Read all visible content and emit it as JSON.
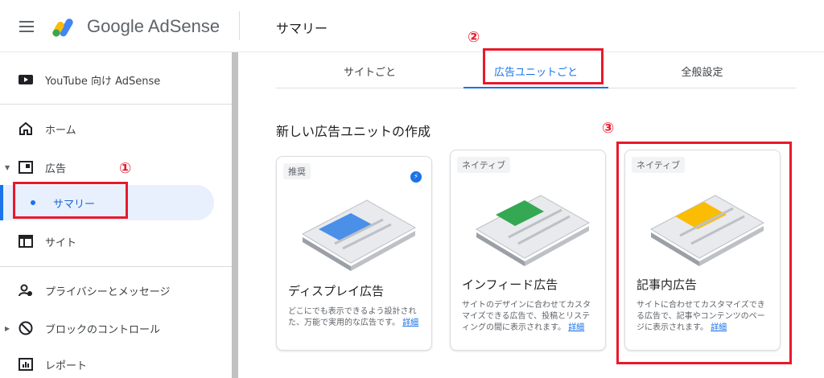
{
  "header": {
    "app_name": "Google AdSense",
    "page_title": "サマリー"
  },
  "sidebar": {
    "youtube": "YouTube 向け AdSense",
    "home": "ホーム",
    "ads": "広告",
    "summary": "サマリー",
    "sites": "サイト",
    "privacy": "プライバシーとメッセージ",
    "block": "ブロックのコントロール",
    "report": "レポート"
  },
  "tabs": [
    "サイトごと",
    "広告ユニットごと",
    "全般設定"
  ],
  "section_title": "新しい広告ユニットの作成",
  "cards": [
    {
      "badge": "推奨",
      "title": "ディスプレイ広告",
      "desc": "どこにでも表示できるよう設計された、万能で実用的な広告です。",
      "link": "詳細"
    },
    {
      "badge": "ネイティブ",
      "title": "インフィード広告",
      "desc": "サイトのデザインに合わせてカスタマイズできる広告で、投稿とリスティングの間に表示されます。",
      "link": "詳細"
    },
    {
      "badge": "ネイティブ",
      "title": "記事内広告",
      "desc": "サイトに合わせてカスタマイズできる広告で、記事やコンテンツのページに表示されます。",
      "link": "詳細"
    }
  ],
  "annotations": [
    "①",
    "②",
    "③"
  ],
  "colors": {
    "accent": "#1a73e8",
    "annotation": "#e8192c"
  }
}
